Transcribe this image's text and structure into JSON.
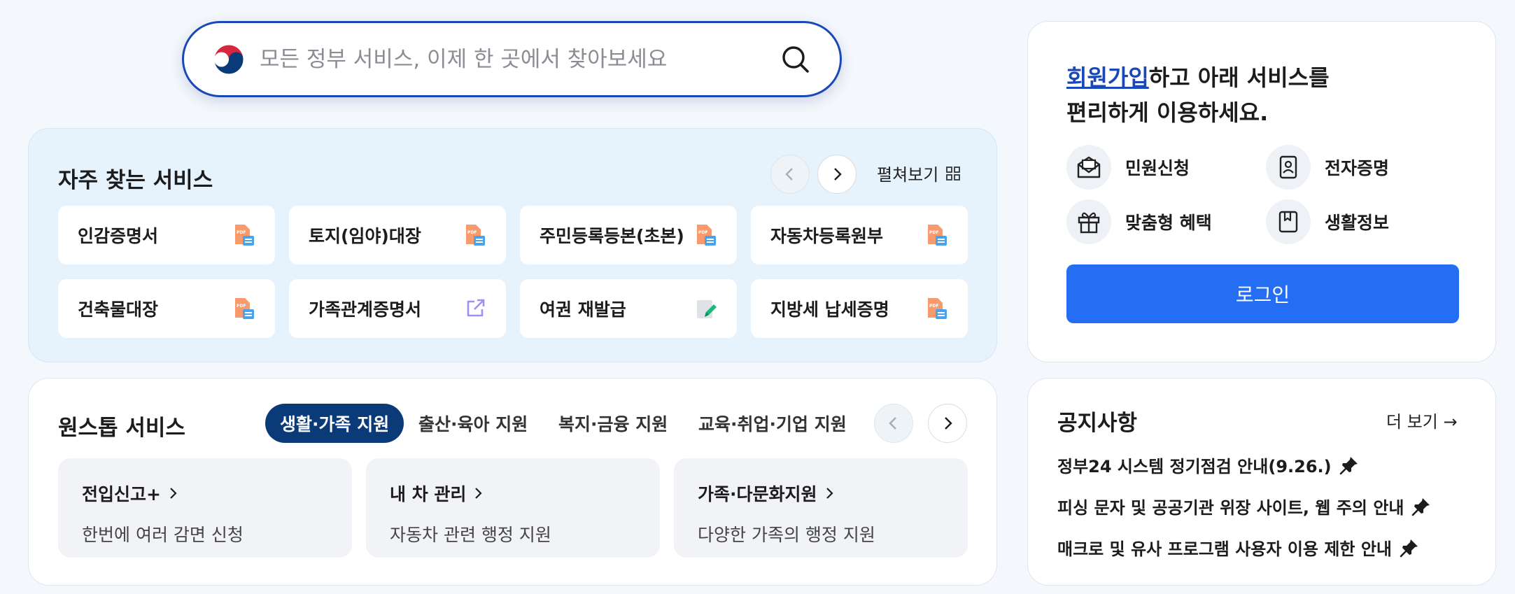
{
  "search": {
    "placeholder": "모든 정부 서비스, 이제 한 곳에서 찾아보세요",
    "value": ""
  },
  "frequent": {
    "title": "자주 찾는 서비스",
    "spread_label": "펼쳐보기",
    "items": [
      {
        "label": "인감증명서",
        "icon": "pdf-doc-icon"
      },
      {
        "label": "토지(임야)대장",
        "icon": "pdf-doc-icon"
      },
      {
        "label": "주민등록등본(초본)",
        "icon": "pdf-doc-icon"
      },
      {
        "label": "자동차등록원부",
        "icon": "pdf-doc-icon"
      },
      {
        "label": "건축물대장",
        "icon": "pdf-doc-icon"
      },
      {
        "label": "가족관계증명서",
        "icon": "external-link-icon"
      },
      {
        "label": "여권 재발급",
        "icon": "edit-doc-icon"
      },
      {
        "label": "지방세 납세증명",
        "icon": "pdf-doc-icon"
      }
    ]
  },
  "account": {
    "join_link": "회원가입",
    "promo_rest_line1": "하고 아래 서비스를",
    "promo_line2": "편리하게 이용하세요.",
    "quick": [
      {
        "label": "민원신청",
        "icon": "envelope-icon"
      },
      {
        "label": "전자증명",
        "icon": "id-badge-icon"
      },
      {
        "label": "맞춤형 혜택",
        "icon": "gift-icon"
      },
      {
        "label": "생활정보",
        "icon": "bookmark-icon"
      }
    ],
    "login_label": "로그인"
  },
  "onestop": {
    "title": "원스톱 서비스",
    "tabs": [
      "생활·가족 지원",
      "출산·육아 지원",
      "복지·금융 지원",
      "교육·취업·기업 지원"
    ],
    "active_tab": 0,
    "cards": [
      {
        "title": "전입신고+",
        "desc": "한번에 여러 감면 신청"
      },
      {
        "title": "내 차 관리",
        "desc": "자동차 관련 행정 지원"
      },
      {
        "title": "가족·다문화지원",
        "desc": "다양한 가족의 행정 지원"
      }
    ]
  },
  "notice": {
    "title": "공지사항",
    "more_label": "더 보기 →",
    "items": [
      "정부24 시스템 정기점검 안내(9.26.)",
      "피싱 문자 및 공공기관 위장 사이트, 웹 주의 안내",
      "매크로 및 유사 프로그램 사용자 이용 제한 안내"
    ]
  },
  "colors": {
    "primary": "#256ef4",
    "navy": "#0b3a78",
    "search_border": "#1a48b8",
    "freq_bg": "#e6f2fc"
  }
}
